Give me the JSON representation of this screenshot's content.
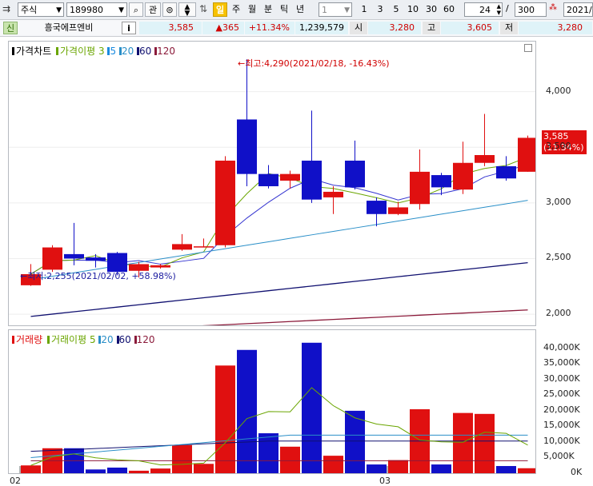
{
  "toolbar": {
    "market": "주식",
    "code": "189980",
    "btn_kwan": "관",
    "period_tabs": [
      "일",
      "주",
      "월",
      "분",
      "틱",
      "년"
    ],
    "interval_value": "1",
    "quick_intervals": [
      "1",
      "3",
      "5",
      "10",
      "30",
      "60"
    ],
    "count_value": "24",
    "slash": "/",
    "total_value": "300",
    "date_value": "2021/0"
  },
  "quote": {
    "badge": "신",
    "name": "흥국에프엔비",
    "info_btn": "i",
    "price": "3,585",
    "change": "▲365",
    "change_pct": "+11.34%",
    "volume": "1,239,579",
    "open_label": "시",
    "open": "3,280",
    "high_label": "고",
    "high": "3,605",
    "low_label": "저",
    "low": "3,280"
  },
  "price_panel": {
    "legend_title": "가격차트",
    "legend_ma_label": "가격이평",
    "legend_ma_periods": [
      "3",
      "5",
      "20",
      "60",
      "120"
    ],
    "annotation_high": "←최고:4,290(2021/02/18, -16.43%)",
    "annotation_low": "←최저:2,255(2021/02/02, +58.98%)",
    "last_price_label": "3,585",
    "last_pct_label": "(11.34%)",
    "y_ticks": [
      "4,000",
      "3,500",
      "3,000",
      "2,500",
      "2,000"
    ]
  },
  "volume_panel": {
    "legend_title": "거래량",
    "legend_ma_label": "거래이평",
    "legend_ma_periods": [
      "5",
      "20",
      "60",
      "120"
    ],
    "y_ticks": [
      "40,000K",
      "35,000K",
      "30,000K",
      "25,000K",
      "20,000K",
      "15,000K",
      "10,000K",
      "5,000K",
      "0K"
    ]
  },
  "x_axis": {
    "labels": [
      "02",
      "03"
    ]
  },
  "colors": {
    "up": "#e01010",
    "down": "#1010c8",
    "ma3": "#6aa500",
    "ma5": "#1a8be0",
    "ma20": "#2a8fc8",
    "ma60": "#101070",
    "ma120": "#8b1a3a"
  },
  "chart_data": {
    "type": "candlestick",
    "candles": [
      {
        "o": 2260,
        "h": 2450,
        "l": 2255,
        "c": 2360
      },
      {
        "o": 2400,
        "h": 2620,
        "l": 2380,
        "c": 2600
      },
      {
        "o": 2540,
        "h": 2820,
        "l": 2440,
        "c": 2500
      },
      {
        "o": 2510,
        "h": 2540,
        "l": 2420,
        "c": 2480
      },
      {
        "o": 2550,
        "h": 2560,
        "l": 2350,
        "c": 2380
      },
      {
        "o": 2390,
        "h": 2470,
        "l": 2330,
        "c": 2450
      },
      {
        "o": 2420,
        "h": 2450,
        "l": 2410,
        "c": 2440
      },
      {
        "o": 2580,
        "h": 2720,
        "l": 2570,
        "c": 2630
      },
      {
        "o": 2600,
        "h": 2680,
        "l": 2600,
        "c": 2610
      },
      {
        "o": 2620,
        "h": 3420,
        "l": 2600,
        "c": 3380
      },
      {
        "o": 3750,
        "h": 4290,
        "l": 3150,
        "c": 3260
      },
      {
        "o": 3260,
        "h": 3340,
        "l": 3130,
        "c": 3150
      },
      {
        "o": 3200,
        "h": 3290,
        "l": 3130,
        "c": 3260
      },
      {
        "o": 3380,
        "h": 3830,
        "l": 3000,
        "c": 3030
      },
      {
        "o": 3050,
        "h": 3150,
        "l": 2900,
        "c": 3100
      },
      {
        "o": 3380,
        "h": 3560,
        "l": 3120,
        "c": 3140
      },
      {
        "o": 3020,
        "h": 3050,
        "l": 2790,
        "c": 2900
      },
      {
        "o": 2900,
        "h": 3010,
        "l": 2890,
        "c": 2960
      },
      {
        "o": 2990,
        "h": 3480,
        "l": 2940,
        "c": 3280
      },
      {
        "o": 3250,
        "h": 3270,
        "l": 3070,
        "c": 3140
      },
      {
        "o": 3120,
        "h": 3550,
        "l": 3080,
        "c": 3360
      },
      {
        "o": 3360,
        "h": 3800,
        "l": 3330,
        "c": 3430
      },
      {
        "o": 3330,
        "h": 3420,
        "l": 3200,
        "c": 3220
      },
      {
        "o": 3280,
        "h": 3605,
        "l": 3280,
        "c": 3585
      }
    ],
    "volume_k": [
      2500,
      8000,
      8000,
      1200,
      1800,
      800,
      1500,
      9000,
      3000,
      34500,
      39500,
      12800,
      8500,
      41800,
      5600,
      20000,
      2800,
      4200,
      20500,
      2800,
      19300,
      19000,
      2300,
      1600
    ],
    "ylim_price": [
      1900,
      4450
    ],
    "ylim_volume_k": [
      0,
      42000
    ]
  }
}
